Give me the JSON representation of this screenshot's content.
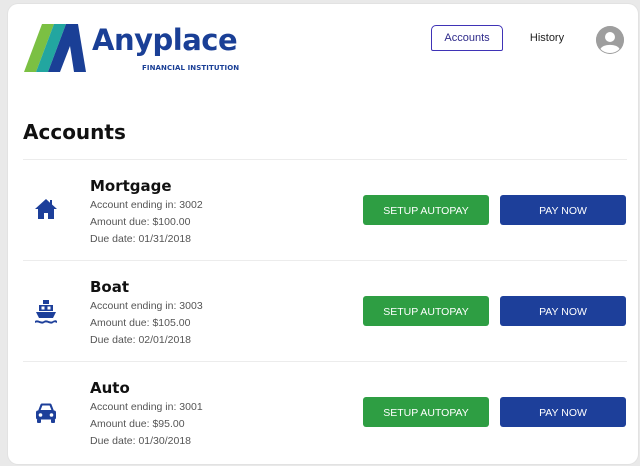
{
  "brand": {
    "name": "Anyplace",
    "subtitle": "FINANCIAL INSTITUTION",
    "colors": {
      "primary": "#1a3f96",
      "green": "#7bc043",
      "teal": "#22a6a0"
    }
  },
  "nav": {
    "tabs": [
      {
        "label": "Accounts",
        "active": true
      },
      {
        "label": "History",
        "active": false
      }
    ],
    "avatar_icon": "user-avatar-icon"
  },
  "page": {
    "title": "Accounts"
  },
  "accounts": [
    {
      "name": "Mortgage",
      "icon": "house-icon",
      "account_line": "Account ending in: 3002",
      "amount_line": "Amount due: $100.00",
      "due_line": "Due date: 01/31/2018",
      "autopay_label": "SETUP AUTOPAY",
      "pay_label": "PAY NOW"
    },
    {
      "name": "Boat",
      "icon": "boat-icon",
      "account_line": "Account ending in: 3003",
      "amount_line": "Amount due: $105.00",
      "due_line": "Due date: 02/01/2018",
      "autopay_label": "SETUP AUTOPAY",
      "pay_label": "PAY NOW"
    },
    {
      "name": "Auto",
      "icon": "car-icon",
      "account_line": "Account ending in: 3001",
      "amount_line": "Amount due: $95.00",
      "due_line": "Due date: 01/30/2018",
      "autopay_label": "SETUP AUTOPAY",
      "pay_label": "PAY NOW"
    }
  ],
  "colors": {
    "autopay_button": "#2e9e43",
    "pay_button": "#1d3f9a",
    "icon": "#1d3f9a",
    "active_tab_border": "#3f33b6"
  }
}
